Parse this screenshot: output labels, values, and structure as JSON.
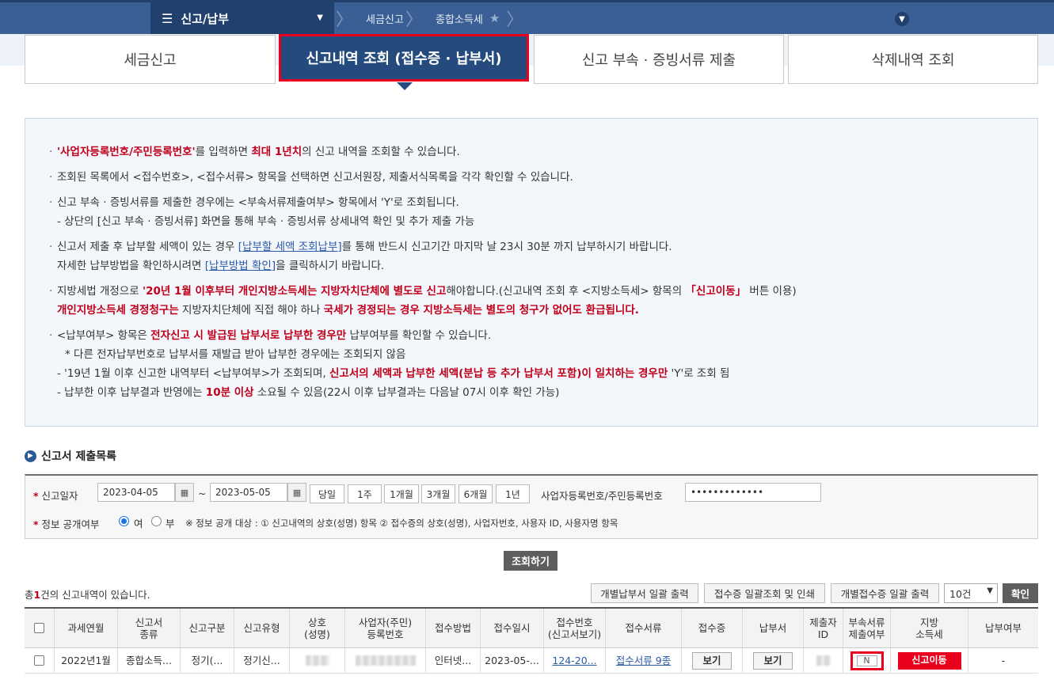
{
  "nav": {
    "menu_label": "신고/납부",
    "crumb1": "세금신고",
    "crumb2": "종합소득세"
  },
  "tabs": [
    {
      "label": "세금신고"
    },
    {
      "label": "신고내역 조회 (접수증 · 납부서)"
    },
    {
      "label": "신고 부속 · 증빙서류 제출"
    },
    {
      "label": "삭제내역 조회"
    }
  ],
  "info": {
    "l1_a": "'사업자등록번호/주민등록번호'",
    "l1_b": "를 입력하면 ",
    "l1_c": "최대 1년치",
    "l1_d": "의 신고 내역을 조회할 수 있습니다.",
    "l2": "조회된 목록에서 <접수번호>, <접수서류> 항목을 선택하면 신고서원장, 제출서식목록을 각각 확인할 수 있습니다.",
    "l3": "신고 부속 · 증빙서류를 제출한 경우에는 <부속서류제출여부> 항목에서 'Y'로 조회됩니다.",
    "l3_sub": "- 상단의 [신고 부속 · 증빙서류] 화면을 통해 부속 · 증빙서류 상세내역 확인 및 추가 제출 가능",
    "l4_a": "신고서 제출 후 납부할 세액이 있는 경우 ",
    "l4_link": "[납부할 세액 조회납부]",
    "l4_b": "를 통해 반드시 신고기간 마지막 날 23시 30분 까지 납부하시기 바랍니다.",
    "l4_sub_a": "자세한 납부방법을 확인하시려면 ",
    "l4_sub_link": "[납부방법 확인]",
    "l4_sub_b": "을 클릭하시기 바랍니다.",
    "l5_a": "지방세법 개정으로 ",
    "l5_b": "'20년 1월 이후부터 개인지방소득세는 지방자치단체에 별도로 신고",
    "l5_c": "해야합니다.(신고내역 조회 후 <지방소득세> 항목의 ",
    "l5_d": "「신고이동」",
    "l5_e": " 버튼 이용)",
    "l5_sub_a": "개인지방소득세 경정청구는",
    "l5_sub_b": " 지방자치단체에 직접 해야 하나 ",
    "l5_sub_c": "국세가 경정되는 경우 지방소득세는 별도의 청구가 없어도 환급됩니다.",
    "l6_a": "<납부여부> 항목은 ",
    "l6_b": "전자신고 시 발급된 납부서로 납부한 경우만",
    "l6_c": " 납부여부를 확인할 수 있습니다.",
    "l6_s1": "* 다른 전자납부번호로 납부서를 재발급 받아 납부한 경우에는 조회되지 않음",
    "l6_s2_a": "- '19년 1월 이후 신고한 내역부터 <납부여부>가 조회되며, ",
    "l6_s2_b": "신고서의 세액과 납부한 세액(분납 등 추가 납부서 포함)이 일치하는 경우만",
    "l6_s2_c": " 'Y'로 조회 됨",
    "l6_s3_a": "- 납부한 이후 납부결과 반영에는 ",
    "l6_s3_b": "10분 이상",
    "l6_s3_c": " 소요될 수 있음(22시 이후 납부결과는 다음날 07시 이후 확인 가능)"
  },
  "section_title": "신고서 제출목록",
  "search": {
    "date_label": "신고일자",
    "date_from": "2023-04-05",
    "tilde": "~",
    "date_to": "2023-05-05",
    "periods": [
      "당일",
      "1주",
      "1개월",
      "3개월",
      "6개월",
      "1년"
    ],
    "id_label": "사업자등록번호/주민등록번호",
    "id_value": "•••••••••••••",
    "public_label": "정보 공개여부",
    "opt_yes": "여",
    "opt_no": "부",
    "public_note": "※ 정보 공개 대상 : ① 신고내역의 상호(성명) 항목 ② 접수증의 상호(성명), 사업자번호, 사용자 ID, 사용자명 항목",
    "search_button": "조회하기"
  },
  "result": {
    "count_pre": "총",
    "count_num": "1",
    "count_post": "건의 신고내역이 있습니다.",
    "btn_print_pay": "개별납부서 일괄 출력",
    "btn_receipt": "접수증 일괄조회 및 인쇄",
    "btn_print_receipt": "개별접수증 일괄 출력",
    "page_size": "10건",
    "ok_button": "확인"
  },
  "table": {
    "headers": [
      "과세연월",
      "신고서\n종류",
      "신고구분",
      "신고유형",
      "상호\n(성명)",
      "사업자(주민)\n등록번호",
      "접수방법",
      "접수일시",
      "접수번호\n(신고서보기)",
      "접수서류",
      "접수증",
      "납부서",
      "제출자\nID",
      "부속서류\n제출여부",
      "지방\n소득세",
      "납부여부"
    ],
    "row": {
      "period": "2022년1월",
      "type": "종합소득...",
      "division": "정기(...",
      "kind": "정기신...",
      "method": "인터넷...",
      "datetime": "2023-05-...",
      "receipt_no": "124-20...",
      "docs": "접수서류 9종",
      "receipt_btn": "보기",
      "payment_btn": "보기",
      "attach": "N",
      "local_btn": "신고이동",
      "paid": "-"
    }
  }
}
